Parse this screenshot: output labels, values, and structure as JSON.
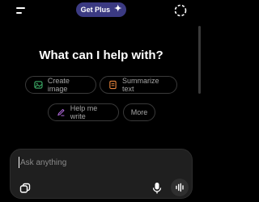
{
  "header": {
    "upgrade_label": "Get Plus",
    "upgrade_icon": "sparkle-plus-icon",
    "menu_icon": "hamburger-menu-icon",
    "new_chat_icon": "new-chat-icon"
  },
  "main": {
    "headline": "What can I help with?",
    "suggestions": [
      {
        "label": "Create image",
        "icon": "image-icon",
        "icon_color": "#3fb36b"
      },
      {
        "label": "Summarize text",
        "icon": "document-icon",
        "icon_color": "#e8843b"
      },
      {
        "label": "Help me write",
        "icon": "pen-icon",
        "icon_color": "#b46ae0"
      },
      {
        "label": "More"
      }
    ]
  },
  "composer": {
    "placeholder": "Ask anything",
    "attach_icon": "attachment-icon",
    "mic_icon": "microphone-icon",
    "voice_icon": "voice-mode-icon"
  },
  "colors": {
    "background": "#000000",
    "upgrade_pill": "#3b3a82",
    "composer_bg": "#1f1f1f",
    "chip_border": "#3a3a3a",
    "muted_text": "#a5a5a5"
  }
}
